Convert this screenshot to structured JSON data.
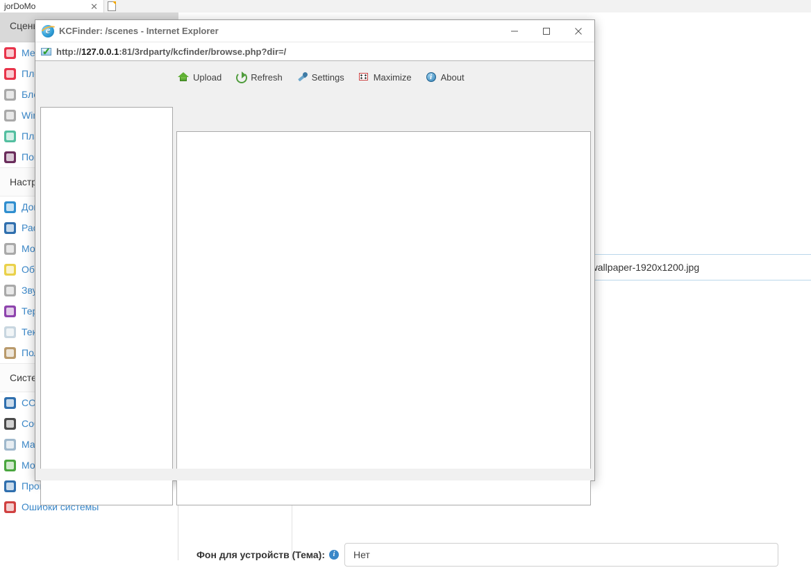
{
  "browser": {
    "tab_title": "jorDoMo",
    "tab_close_glyph": "✕",
    "new_tab_icon": "new-tab-icon"
  },
  "app": {
    "topbar_label": "Сцены",
    "sidebar": {
      "groups": [
        {
          "title": null,
          "items": [
            {
              "label": "Медиацентр",
              "color": "#e8334a",
              "icon": "media-icon"
            },
            {
              "label": "Плееры",
              "color": "#e8334a",
              "icon": "player-icon"
            },
            {
              "label": "Блокнот",
              "color": "#a9a9a9",
              "icon": "notepad-icon"
            },
            {
              "label": "Windows",
              "color": "#a9a9a9",
              "icon": "windows-icon"
            },
            {
              "label": "Планировщик",
              "color": "#53bfa0",
              "icon": "scheduler-icon"
            },
            {
              "label": "Погода",
              "color": "#6b2d5c",
              "icon": "weather-icon"
            }
          ]
        },
        {
          "title": "Настройки",
          "items": [
            {
              "label": "Домашняя страница",
              "color": "#2f8ecf",
              "icon": "home-icon"
            },
            {
              "label": "Расположение",
              "color": "#2f6fae",
              "icon": "location-icon"
            },
            {
              "label": "Мои блоки",
              "color": "#a9a9a9",
              "icon": "blocks-icon"
            },
            {
              "label": "Общие",
              "color": "#ead14a",
              "icon": "tools-icon"
            },
            {
              "label": "Звуковые",
              "color": "#a9a9a9",
              "icon": "sound-icon"
            },
            {
              "label": "Терминалы",
              "color": "#8e44ad",
              "icon": "terminal-icon"
            },
            {
              "label": "Текстовые",
              "color": "#c8d6e0",
              "icon": "text-icon"
            },
            {
              "label": "Пользователи",
              "color": "#b99a6b",
              "icon": "users-icon"
            }
          ]
        },
        {
          "title": "Система",
          "items": [
            {
              "label": "CONNECT",
              "color": "#2f6fae",
              "icon": "connect-icon"
            },
            {
              "label": "События",
              "color": "#4a4a4a",
              "icon": "events-icon"
            },
            {
              "label": "Маркет дополнений",
              "color": "#9fb8cc",
              "icon": "market-icon"
            },
            {
              "label": "Модули",
              "color": "#4aa63f",
              "icon": "modules-icon"
            },
            {
              "label": "Проверка обновлений",
              "color": "#2f6fae",
              "icon": "update-icon"
            },
            {
              "label": "Ошибки системы",
              "color": "#d04040",
              "icon": "errors-icon"
            }
          ]
        }
      ]
    },
    "main": {
      "file_field_value": "-wallpaper-1920x1200.jpg",
      "theme_label": "Фон для устройств (Тема):",
      "theme_info_glyph": "i",
      "theme_value": "Нет"
    }
  },
  "ie_window": {
    "title": "KCFinder: /scenes - Internet Explorer",
    "favicon": "internet-explorer-icon",
    "favicon_letter": "e",
    "url_prefix": "http://",
    "url_host": "127.0.0.1",
    "url_rest": ":81/3rdparty/kcfinder/browse.php?dir=/",
    "security_icon": "secure-page-icon",
    "window_buttons": [
      {
        "name": "minimize-button",
        "glyph": "minimize"
      },
      {
        "name": "maximize-button",
        "glyph": "maximize"
      },
      {
        "name": "close-button",
        "glyph": "close"
      }
    ],
    "kcfinder": {
      "toolbar": [
        {
          "label": "Upload",
          "icon": "upload-icon",
          "cls": "ti-upload"
        },
        {
          "label": "Refresh",
          "icon": "refresh-icon",
          "cls": "ti-refresh"
        },
        {
          "label": "Settings",
          "icon": "settings-icon",
          "cls": "ti-settings"
        },
        {
          "label": "Maximize",
          "icon": "maximize-icon",
          "cls": "ti-maximize"
        },
        {
          "label": "About",
          "icon": "about-icon",
          "cls": "ti-about"
        }
      ],
      "folder_pane_empty": "",
      "file_pane_empty": ""
    }
  }
}
